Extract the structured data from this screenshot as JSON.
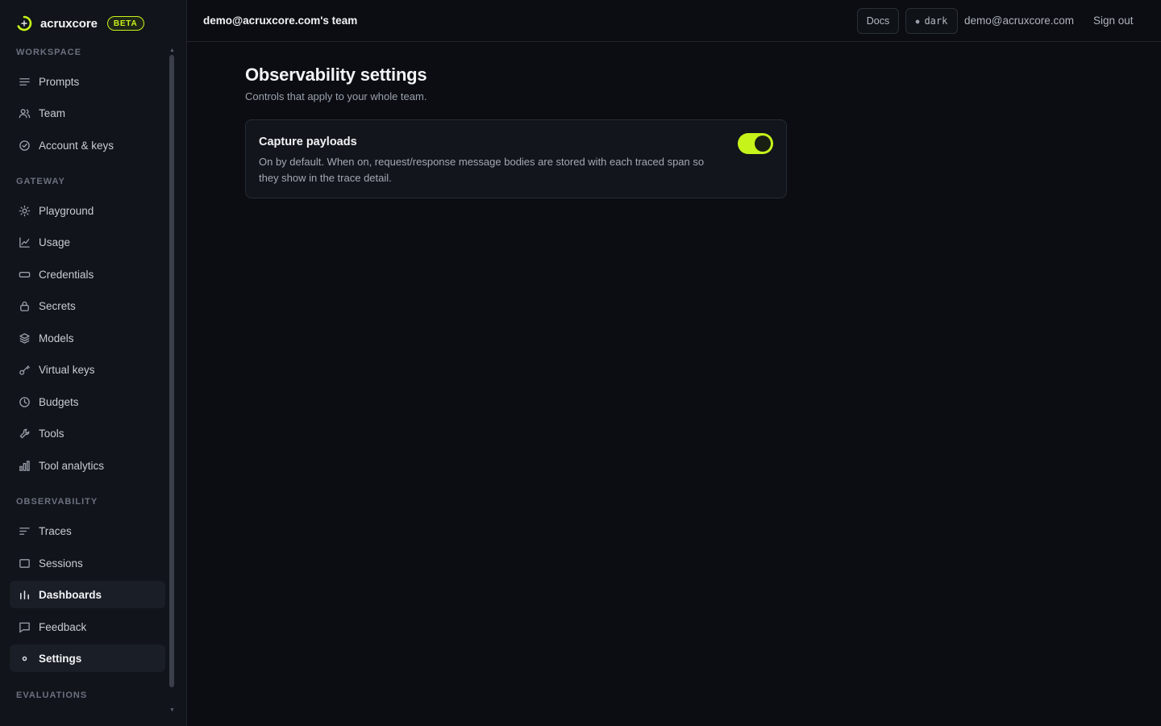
{
  "brand": {
    "name": "acruxcore",
    "badge": "BETA",
    "accent": "#c6f31a"
  },
  "sidebar": {
    "sections": {
      "workspace": "WORKSPACE",
      "gateway": "GATEWAY",
      "observability": "OBSERVABILITY",
      "evaluations": "EVALUATIONS"
    },
    "workspace_items": [
      {
        "label": "Prompts",
        "icon": "list-icon"
      },
      {
        "label": "Team",
        "icon": "users-icon"
      },
      {
        "label": "Account & keys",
        "icon": "check-circle-icon"
      }
    ],
    "gateway_items": [
      {
        "label": "Playground",
        "icon": "sun-icon"
      },
      {
        "label": "Usage",
        "icon": "line-chart-icon"
      },
      {
        "label": "Credentials",
        "icon": "card-icon"
      },
      {
        "label": "Secrets",
        "icon": "lock-icon"
      },
      {
        "label": "Models",
        "icon": "layers-icon"
      },
      {
        "label": "Virtual keys",
        "icon": "key-icon"
      },
      {
        "label": "Budgets",
        "icon": "clock-icon"
      },
      {
        "label": "Tools",
        "icon": "wrench-icon"
      },
      {
        "label": "Tool analytics",
        "icon": "bar-chart-icon"
      }
    ],
    "observability_items": [
      {
        "label": "Traces",
        "icon": "traces-icon"
      },
      {
        "label": "Sessions",
        "icon": "square-icon"
      },
      {
        "label": "Dashboards",
        "icon": "dashboard-bars-icon",
        "active": true
      },
      {
        "label": "Feedback",
        "icon": "message-icon"
      },
      {
        "label": "Settings",
        "icon": "dot-icon",
        "active": true
      }
    ]
  },
  "header": {
    "team": "demo@acruxcore.com's team",
    "docs_label": "Docs",
    "theme_label": "dark",
    "user_email": "demo@acruxcore.com",
    "signout_label": "Sign out"
  },
  "main": {
    "title": "Observability settings",
    "subtitle": "Controls that apply to your whole team.",
    "setting": {
      "title": "Capture payloads",
      "description": "On by default. When on, request/response message bodies are stored with each traced span so they show in the trace detail.",
      "enabled": true
    }
  }
}
